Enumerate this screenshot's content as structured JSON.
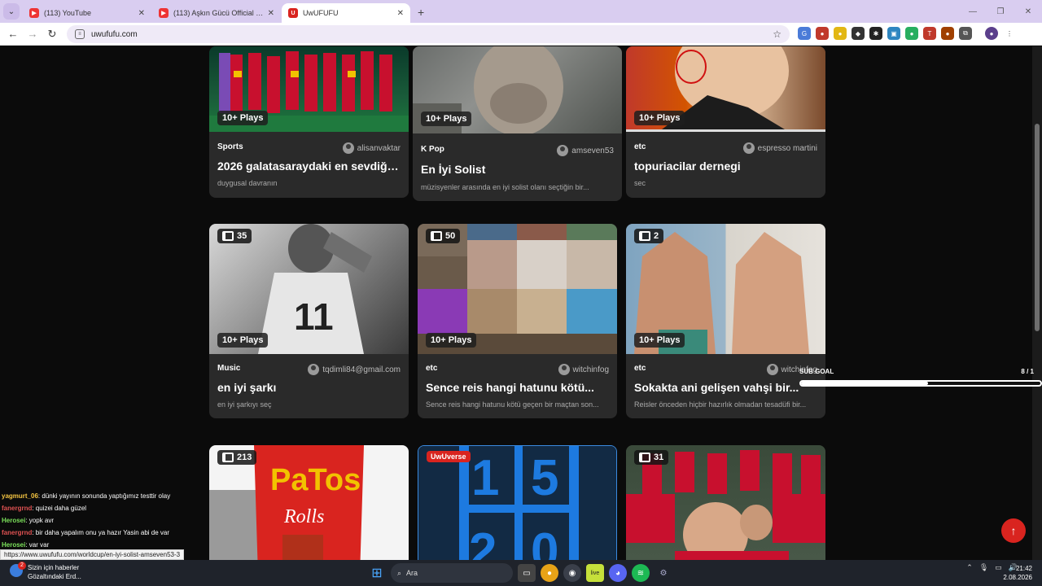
{
  "browser": {
    "tabs": [
      {
        "title": "(113) YouTube",
        "favicon": "youtube-icon",
        "active": false
      },
      {
        "title": "(113) Aşkın Gücü Official - YouT",
        "favicon": "youtube-icon",
        "active": false
      },
      {
        "title": "UwUFUFU",
        "favicon": "uwufufu-icon",
        "active": true
      }
    ],
    "url": "uwufufu.com",
    "status_url": "https://www.uwufufu.com/worldcup/en-iyi-solist-amseven53-3"
  },
  "cards": [
    {
      "plays": "10+ Plays",
      "category": "Sports",
      "author": "alisanvaktar",
      "title": "2026 galatasaraydaki en sevdiğin...",
      "description": "duygusal davranın"
    },
    {
      "plays": "10+ Plays",
      "category": "K Pop",
      "author": "amseven53",
      "title": "En İyi Solist",
      "description": "müzisyenler arasında en iyi solist olanı seçtiğin bir..."
    },
    {
      "plays": "10+ Plays",
      "category": "etc",
      "author": "espresso martini",
      "title": "topuriacilar dernegi",
      "description": "sec"
    },
    {
      "count": "35",
      "plays": "10+ Plays",
      "category": "Music",
      "author": "tqdimli84@gmail.com",
      "title": "en iyi şarkı",
      "description": "en iyi şarkıyı seç"
    },
    {
      "count": "50",
      "plays": "10+ Plays",
      "category": "etc",
      "author": "witchinfog",
      "title": "Sence reis hangi hatunu kötü...",
      "description": "Sence reis hangi hatunu kötü geçen bir maçtan son..."
    },
    {
      "count": "2",
      "plays": "10+ Plays",
      "category": "etc",
      "author": "witchinfog",
      "title": "Sokakta ani gelişen vahşi bir...",
      "description": "Reisler önceden hiçbir hazırlık olmadan tesadüfi bir..."
    },
    {
      "count": "213"
    },
    {
      "badge": "UwUverse"
    },
    {
      "count": "31"
    }
  ],
  "overlay": {
    "sub_goal_label": "SUB GOAL",
    "sub_goal_value": "8 / 1",
    "sub_goal_fraction": 0.53,
    "chat": [
      {
        "user": "yagmurt_06",
        "color": "#f5c542",
        "message": ": dünki yayının sonunda yaptığımız testtir olay"
      },
      {
        "user": "fanergrnd",
        "color": "#e05252",
        "message": ": quizei daha güzel"
      },
      {
        "user": "Herosei",
        "color": "#7be05a",
        "message": ": yopk avr"
      },
      {
        "user": "fanergrnd",
        "color": "#e05252",
        "message": ": bir daha yapalım onu ya hazır Yasin abi de var"
      },
      {
        "user": "Herosei",
        "color": "#7be05a",
        "message": ": var var"
      }
    ]
  },
  "taskbar": {
    "news_title": "Sizin için haberler",
    "news_sub": "Gözaltındaki Erd...",
    "news_badge": "2",
    "search_placeholder": "Ara",
    "time": "21:42",
    "date": "2.08.2026"
  }
}
